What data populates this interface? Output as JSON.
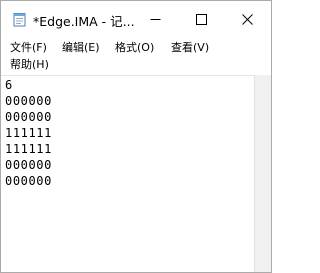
{
  "window": {
    "title": "*Edge.IMA - 记..."
  },
  "menu": {
    "items": [
      {
        "label": "文件(F)"
      },
      {
        "label": "编辑(E)"
      },
      {
        "label": "格式(O)"
      },
      {
        "label": "查看(V)"
      },
      {
        "label": "帮助(H)"
      }
    ]
  },
  "editor": {
    "lines": [
      "6",
      "000000",
      "000000",
      "111111",
      "111111",
      "000000",
      "000000"
    ]
  },
  "icons": {
    "app": "notepad-icon",
    "minimize": "minimize-icon",
    "maximize": "maximize-icon",
    "close": "close-icon"
  }
}
